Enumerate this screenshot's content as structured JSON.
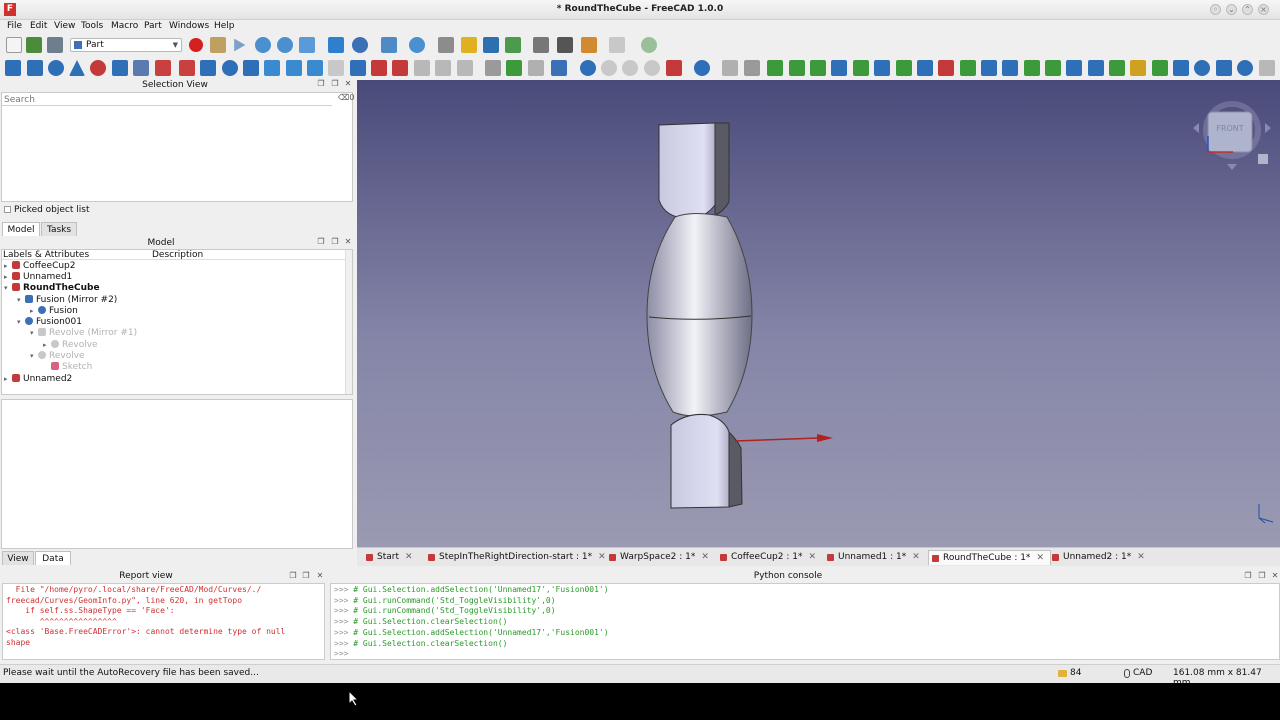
{
  "window": {
    "title": "* RoundTheCube - FreeCAD 1.0.0",
    "logo": "F"
  },
  "menu": [
    "File",
    "Edit",
    "View",
    "Tools",
    "Macro",
    "Part",
    "Windows",
    "Help"
  ],
  "workbench": {
    "selected": "Part"
  },
  "selection_view": {
    "title": "Selection View",
    "search_placeholder": "Search",
    "picked_list_label": "Picked object list"
  },
  "combo_tabs": {
    "model": "Model",
    "tasks": "Tasks"
  },
  "model_panel": {
    "title": "Model",
    "col_labels": "Labels & Attributes",
    "col_desc": "Description",
    "tree": [
      {
        "label": "CoffeeCup2"
      },
      {
        "label": "Unnamed1"
      },
      {
        "label": "RoundTheCube"
      },
      {
        "label": "Fusion (Mirror #2)"
      },
      {
        "label": "Fusion"
      },
      {
        "label": "Fusion001"
      },
      {
        "label": "Revolve (Mirror #1)"
      },
      {
        "label": "Revolve"
      },
      {
        "label": "Revolve"
      },
      {
        "label": "Sketch"
      },
      {
        "label": "Unnamed2"
      }
    ]
  },
  "navcube": {
    "face": "FRONT"
  },
  "doc_tabs": [
    {
      "label": "Start"
    },
    {
      "label": "StepInTheRightDirection-start : 1*"
    },
    {
      "label": "WarpSpace2 : 1*"
    },
    {
      "label": "CoffeeCup2 : 1*"
    },
    {
      "label": "Unnamed1 : 1*"
    },
    {
      "label": "RoundTheCube : 1*"
    },
    {
      "label": "Unnamed2 : 1*"
    }
  ],
  "doc_tab_close": "✕",
  "bottom_tabs": {
    "view": "View",
    "data": "Data"
  },
  "report_view": {
    "title": "Report view",
    "lines": [
      "  File \"/home/pyro/.local/share/FreeCAD/Mod/Curves/./",
      "freecad/Curves/GeomInfo.py\", line 620, in getTopo",
      "    if self.ss.ShapeType == 'Face':",
      "       ^^^^^^^^^^^^^^^^",
      "<class 'Base.FreeCADError'>: cannot determine type of null",
      "shape"
    ]
  },
  "python_console": {
    "title": "Python console",
    "prompt": ">>> ",
    "lines": [
      "# Gui.Selection.addSelection('Unnamed17','Fusion001')",
      "# Gui.runCommand('Std_ToggleVisibility',0)",
      "# Gui.runCommand('Std_ToggleVisibility',0)",
      "# Gui.Selection.clearSelection()",
      "# Gui.Selection.addSelection('Unnamed17','Fusion001')",
      "# Gui.Selection.clearSelection()",
      ""
    ]
  },
  "statusbar": {
    "message": "Please wait until the AutoRecovery file has been saved...",
    "count": "84",
    "nav_style": "CAD",
    "dimensions": "161.08 mm x 81.47 mm"
  },
  "colors": {
    "viewport_top": "#4a4a7a",
    "viewport_bottom": "#9a9ab2",
    "record": "#d62020",
    "error_text": "#d03030",
    "console_comment": "#2a9a2a"
  }
}
